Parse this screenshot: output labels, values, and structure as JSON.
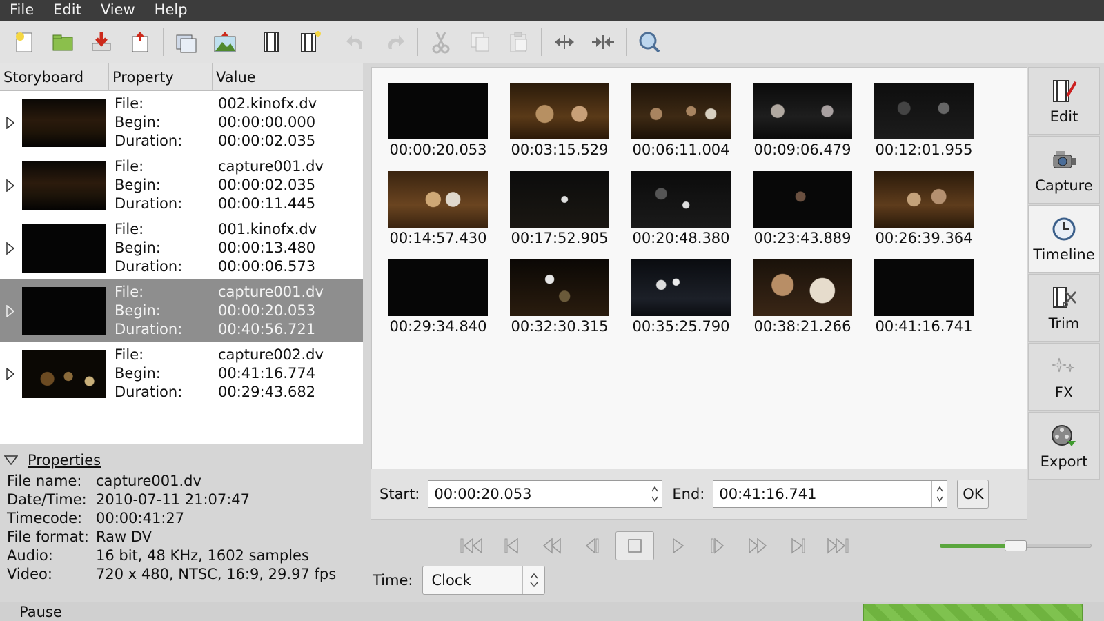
{
  "menu": [
    "File",
    "Edit",
    "View",
    "Help"
  ],
  "toolbar": {
    "icons": [
      "new-icon",
      "open-icon",
      "save-icon",
      "save-as-icon",
      "export-frame-icon",
      "publish-icon",
      "insert-before-icon",
      "insert-after-icon",
      "undo-icon",
      "redo-icon",
      "cut-icon",
      "copy-icon",
      "paste-icon",
      "split-icon",
      "join-icon",
      "zoom-icon"
    ]
  },
  "storyboard": {
    "headers": [
      "Storyboard",
      "Property",
      "Value"
    ],
    "rows": [
      {
        "file": "002.kinofx.dv",
        "begin": "00:00:00.000",
        "duration": "00:00:02.035"
      },
      {
        "file": "capture001.dv",
        "begin": "00:00:02.035",
        "duration": "00:00:11.445"
      },
      {
        "file": "001.kinofx.dv",
        "begin": "00:00:13.480",
        "duration": "00:00:06.573"
      },
      {
        "file": "capture001.dv",
        "begin": "00:00:20.053",
        "duration": "00:40:56.721"
      },
      {
        "file": "capture002.dv",
        "begin": "00:41:16.774",
        "duration": "00:29:43.682"
      }
    ],
    "labels": {
      "file": "File:",
      "begin": "Begin:",
      "duration": "Duration:"
    },
    "selected_index": 3
  },
  "properties": {
    "title": "Properties",
    "items": [
      {
        "k": "File name:",
        "v": "capture001.dv"
      },
      {
        "k": "Date/Time:",
        "v": "2010-07-11 21:07:47"
      },
      {
        "k": "Timecode:",
        "v": "00:00:41:27"
      },
      {
        "k": "File format:",
        "v": "Raw DV"
      },
      {
        "k": "Audio:",
        "v": "16 bit, 48 KHz, 1602 samples"
      },
      {
        "k": "Video:",
        "v": "720 x 480, NTSC, 16:9, 29.97 fps"
      }
    ]
  },
  "timeline": {
    "frames": [
      "00:00:20.053",
      "00:03:15.529",
      "00:06:11.004",
      "00:09:06.479",
      "00:12:01.955",
      "00:14:57.430",
      "00:17:52.905",
      "00:20:48.380",
      "00:23:43.889",
      "00:26:39.364",
      "00:29:34.840",
      "00:32:30.315",
      "00:35:25.790",
      "00:38:21.266",
      "00:41:16.741"
    ],
    "start_label": "Start:",
    "start_value": "00:00:20.053",
    "end_label": "End:",
    "end_value": "00:41:16.741",
    "ok_label": "OK"
  },
  "tabs": [
    "Edit",
    "Capture",
    "Timeline",
    "Trim",
    "FX",
    "Export"
  ],
  "active_tab": "Timeline",
  "transport": [
    "first-icon",
    "prev-scene-icon",
    "rewind-icon",
    "back-frame-icon",
    "stop-icon",
    "play-icon",
    "forward-frame-icon",
    "fast-forward-icon",
    "next-scene-icon",
    "last-icon"
  ],
  "volume_level": 0.5,
  "time_label": "Time:",
  "time_mode": "Clock",
  "status": "Pause",
  "colors": {
    "selected_row": "#8e8e8e",
    "progress": "#7fc24f",
    "volume": "#5aa63d"
  }
}
